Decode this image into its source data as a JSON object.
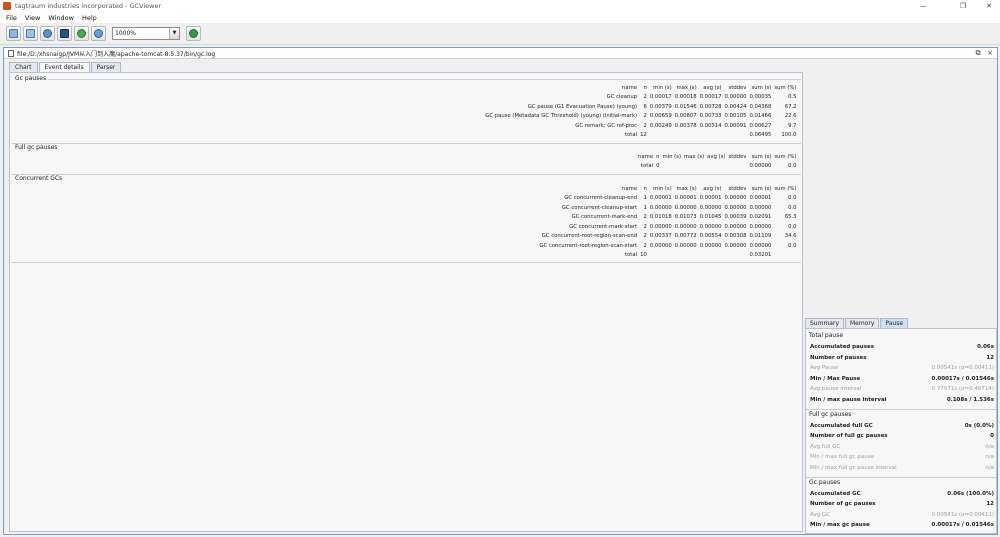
{
  "window": {
    "title": "tagtraum industries incorporated - GCViewer",
    "controls": {
      "minimize": "—",
      "restore": "❐",
      "close": "✕"
    }
  },
  "menu": [
    "File",
    "View",
    "Window",
    "Help"
  ],
  "toolbar": {
    "zoom_value": "1000%",
    "icons": [
      "open-file-icon",
      "open-url-icon",
      "refresh-icon",
      "export-icon",
      "watch-icon",
      "about-icon",
      "legend-icon"
    ]
  },
  "document": {
    "path": "file:/D:/xhsnaigp/JVM从入门到入魔/apache-tomcat-8.5.37/bin/gc.log",
    "tabs": [
      "Chart",
      "Event details",
      "Parser"
    ],
    "active_tab": "Event details"
  },
  "event_details": {
    "gc_pauses": {
      "title": "Gc pauses",
      "headers": [
        "name",
        "n",
        "min (s)",
        "max (s)",
        "avg (s)",
        "stddev",
        "sum (s)",
        "sum (%)"
      ],
      "rows": [
        [
          "GC cleanup",
          "2",
          "0.00017",
          "0.00018",
          "0.00017",
          "0.00000",
          "0.00035",
          "0.5"
        ],
        [
          "GC pause (G1 Evacuation Pause) (young)",
          "6",
          "0.00379",
          "0.01546",
          "0.00728",
          "0.00424",
          "0.04368",
          "67.2"
        ],
        [
          "GC pause (Metadata GC Threshold) (young) (initial-mark)",
          "2",
          "0.00659",
          "0.00807",
          "0.00733",
          "0.00105",
          "0.01466",
          "22.6"
        ],
        [
          "GC remark; GC ref-proc",
          "2",
          "0.00249",
          "0.00378",
          "0.00314",
          "0.00091",
          "0.00627",
          "9.7"
        ]
      ],
      "total": [
        "total",
        "12",
        "",
        "",
        "",
        "",
        "0.06495",
        "100.0"
      ]
    },
    "full_gc_pauses": {
      "title": "Full gc pauses",
      "headers": [
        "name",
        "n",
        "min (s)",
        "max (s)",
        "avg (s)",
        "stddev",
        "sum (s)",
        "sum (%)"
      ],
      "total": [
        "total",
        "0",
        "",
        "",
        "",
        "",
        "0.00000",
        "0.0"
      ]
    },
    "concurrent_gcs": {
      "title": "Concurrent GCs",
      "headers": [
        "name",
        "n",
        "min (s)",
        "max (s)",
        "avg (s)",
        "stddev",
        "sum (s)",
        "sum (%)"
      ],
      "rows": [
        [
          "GC concurrent-cleanup-end",
          "1",
          "0.00001",
          "0.00001",
          "0.00001",
          "0.00000",
          "0.00001",
          "0.0"
        ],
        [
          "GC concurrent-cleanup-start",
          "1",
          "0.00000",
          "0.00000",
          "0.00000",
          "0.00000",
          "0.00000",
          "0.0"
        ],
        [
          "GC concurrent-mark-end",
          "2",
          "0.01018",
          "0.01073",
          "0.01045",
          "0.00039",
          "0.02091",
          "65.3"
        ],
        [
          "GC concurrent-mark-start",
          "2",
          "0.00000",
          "0.00000",
          "0.00000",
          "0.00000",
          "0.00000",
          "0.0"
        ],
        [
          "GC concurrent-root-region-scan-end",
          "2",
          "0.00337",
          "0.00772",
          "0.00554",
          "0.00308",
          "0.01109",
          "34.6"
        ],
        [
          "GC concurrent-root-region-scan-start",
          "2",
          "0.00000",
          "0.00000",
          "0.00000",
          "0.00000",
          "0.00000",
          "0.0"
        ]
      ],
      "total": [
        "total",
        "10",
        "",
        "",
        "",
        "",
        "0.03201",
        ""
      ]
    }
  },
  "summary_panel": {
    "tabs": [
      "Summary",
      "Memory",
      "Pause"
    ],
    "active_tab": "Pause",
    "groups": [
      {
        "title": "Total pause",
        "rows": [
          {
            "label": "Accumulated pauses",
            "value": "0.06s",
            "style": "bold"
          },
          {
            "label": "Number of pauses",
            "value": "12",
            "style": "bold"
          },
          {
            "label": "Avg Pause",
            "value": "0.00541s (σ=0.00411)",
            "style": "dim"
          },
          {
            "label": "Min / Max Pause",
            "value": "0.00017s / 0.01546s",
            "style": "bold"
          },
          {
            "label": "Avg pause interval",
            "value": "0.77971s (σ=0.46714)",
            "style": "dim"
          },
          {
            "label": "Min / max pause interval",
            "value": "0.108s / 1.536s",
            "style": "bold"
          }
        ]
      },
      {
        "title": "Full gc pauses",
        "rows": [
          {
            "label": "Accumulated full GC",
            "value": "0s (0.0%)",
            "style": "bold"
          },
          {
            "label": "Number of full gc pauses",
            "value": "0",
            "style": "bold"
          },
          {
            "label": "Avg full GC",
            "value": "n/a",
            "style": "dim"
          },
          {
            "label": "Min / max full gc pause",
            "value": "n/a",
            "style": "dim"
          },
          {
            "label": "Min / max full gc pause interval",
            "value": "n/a",
            "style": "dim"
          }
        ]
      },
      {
        "title": "Gc pauses",
        "rows": [
          {
            "label": "Accumulated GC",
            "value": "0.06s (100.0%)",
            "style": "bold"
          },
          {
            "label": "Number of gc pauses",
            "value": "12",
            "style": "bold"
          },
          {
            "label": "Avg GC",
            "value": "0.00541s (σ=0.00411)",
            "style": "dim"
          },
          {
            "label": "Min / max gc pause",
            "value": "0.00017s / 0.01546s",
            "style": "bold"
          }
        ]
      }
    ]
  },
  "colors": {
    "frame_border": "#7a9cc9",
    "active_tab": "#cfe0f4",
    "app_icon": "#c9541d"
  }
}
